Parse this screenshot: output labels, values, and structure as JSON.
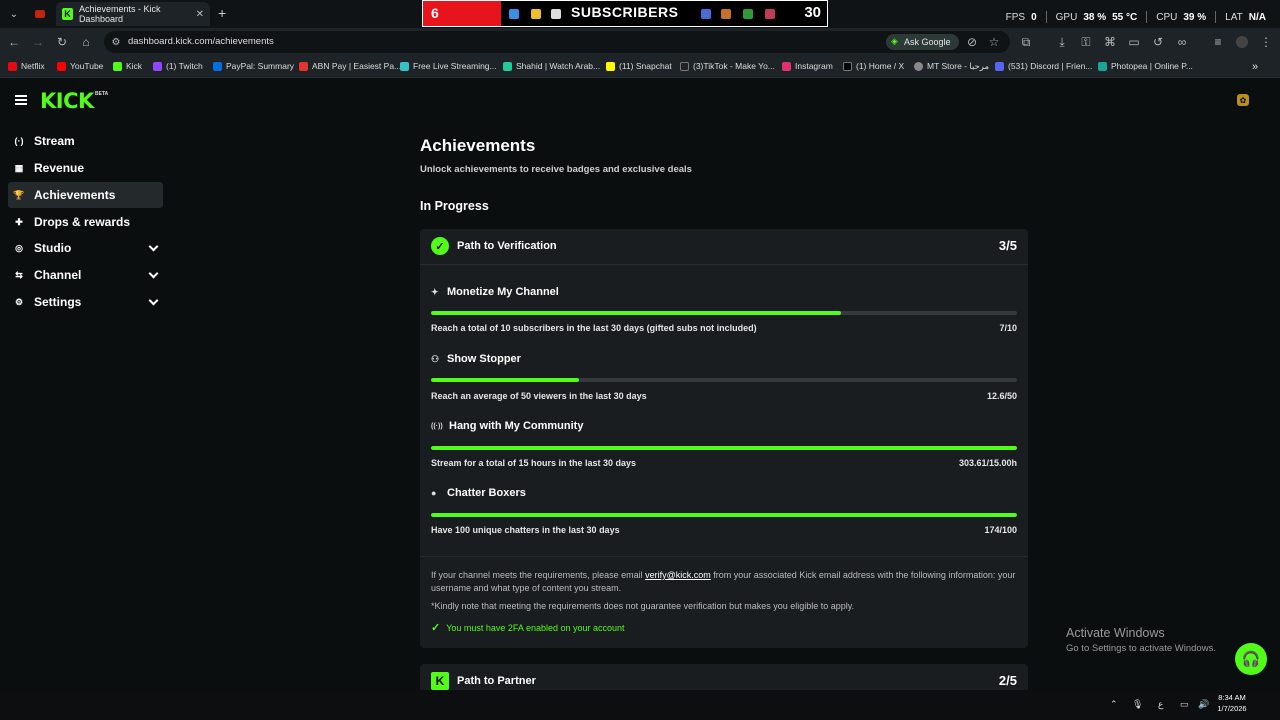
{
  "browser": {
    "tab_title": "Achievements - Kick Dashboard",
    "url": "dashboard.kick.com/achievements",
    "ask_google": "Ask Google",
    "hud": {
      "fps_label": "FPS",
      "fps": "0",
      "gpu_label": "GPU",
      "gpu": "38 %",
      "gpu_temp": "55 °C",
      "cpu_label": "CPU",
      "cpu": "39 %",
      "lat_label": "LAT",
      "lat": "N/A"
    },
    "bookmarks": [
      "Netflix",
      "YouTube",
      "Kick",
      "(1) Twitch",
      "PayPal: Summary",
      "ABN Pay | Easiest Pa...",
      "Free Live Streaming...",
      "Shahid | Watch Arab...",
      "(11) Snapchat",
      "(3)TikTok - Make Yo...",
      "Instagram",
      "(1) Home / X",
      "MT Store - مرحبا",
      "(531) Discord | Frien...",
      "Photopea | Online P..."
    ],
    "bookmark_colors": [
      "#e50914",
      "#ff0000",
      "#53fc18",
      "#9146ff",
      "#0070e0",
      "#e3342f",
      "#36c1c9",
      "#20c997",
      "#fffc00",
      "#222",
      "#e1306c",
      "#000",
      "#888",
      "#5865f2",
      "#18a497"
    ]
  },
  "header": {
    "logo": "KICK",
    "beta": "BETA"
  },
  "sidebar": {
    "items": [
      {
        "label": "Stream",
        "icon": "stream-icon",
        "glyph": "(·)",
        "expandable": false,
        "active": false
      },
      {
        "label": "Revenue",
        "icon": "revenue-icon",
        "glyph": "▦",
        "expandable": false,
        "active": false
      },
      {
        "label": "Achievements",
        "icon": "trophy-icon",
        "glyph": "🏆",
        "expandable": false,
        "active": true
      },
      {
        "label": "Drops & rewards",
        "icon": "gift-icon",
        "glyph": "✚",
        "expandable": false,
        "active": false
      },
      {
        "label": "Studio",
        "icon": "studio-icon",
        "glyph": "◎",
        "expandable": true,
        "active": false
      },
      {
        "label": "Channel",
        "icon": "channel-icon",
        "glyph": "⇆",
        "expandable": true,
        "active": false
      },
      {
        "label": "Settings",
        "icon": "gear-icon",
        "glyph": "⚙",
        "expandable": true,
        "active": false
      }
    ]
  },
  "main": {
    "title": "Achievements",
    "subtitle": "Unlock achievements to receive badges and exclusive deals",
    "section": "In Progress",
    "verification": {
      "title": "Path to Verification",
      "count": "3/5",
      "achievements": [
        {
          "title": "Monetize My Channel",
          "glyph": "✦",
          "desc": "Reach a total of 10 subscribers in the last 30 days (gifted subs not included)",
          "value": "7/10",
          "progress": 0.7
        },
        {
          "title": "Show Stopper",
          "glyph": "⚇",
          "desc": "Reach an average of 50 viewers in the last 30 days",
          "value": "12.6/50",
          "progress": 0.252
        },
        {
          "title": "Hang with My Community",
          "glyph": "((·))",
          "desc": "Stream for a total of 15 hours in the last 30 days",
          "value": "303.61/15.00h",
          "progress": 1.0
        },
        {
          "title": "Chatter Boxers",
          "glyph": "●",
          "desc": "Have 100 unique chatters in the last 30 days",
          "value": "174/100",
          "progress": 1.0
        }
      ],
      "info_before": "If your channel meets the requirements, please email ",
      "email": "verify@kick.com",
      "info_after": " from your associated Kick email address with the following information: your username and what type of content you stream.",
      "note": "*Kindly note that meeting the requirements does not guarantee verification but makes you eligible to apply.",
      "twofa": "You must have 2FA enabled on your account"
    },
    "partner": {
      "title": "Path to Partner",
      "count": "2/5"
    }
  },
  "windows": {
    "activate_title": "Activate Windows",
    "activate_sub": "Go to Settings to activate Windows.",
    "time": "8:34 AM",
    "date": "1/7/2026"
  },
  "overlay": {
    "left_number": "6",
    "label": "SUBSCRIBERS",
    "right_number": "30"
  },
  "colors": {
    "accent": "#53fc18",
    "background": "#0b0e0f",
    "card": "#191d1f"
  }
}
